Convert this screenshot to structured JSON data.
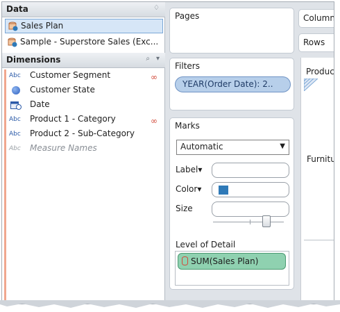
{
  "data_pane": {
    "header": "Data",
    "header_control": "♢",
    "sources": [
      {
        "label": "Sales Plan",
        "selected": true
      },
      {
        "label": "Sample - Superstore Sales (Exc...",
        "selected": false
      }
    ]
  },
  "dimensions_pane": {
    "header": "Dimensions",
    "search_glyph": "⌕",
    "menu_glyph": "▾",
    "items": [
      {
        "label": "Customer Segment",
        "type": "Abc",
        "linked": true
      },
      {
        "label": "Customer State",
        "type": "globe",
        "linked": false
      },
      {
        "label": "Date",
        "type": "calendar",
        "linked": false
      },
      {
        "label": "Product 1 - Category",
        "type": "Abc",
        "linked": true
      },
      {
        "label": "Product 2 - Sub-Category",
        "type": "Abc",
        "linked": false
      },
      {
        "label": "Measure Names",
        "type": "Abc",
        "linked": false
      }
    ],
    "type_abbrev": "Abc",
    "link_glyph": "∞"
  },
  "pages": {
    "title": "Pages"
  },
  "filters": {
    "title": "Filters",
    "pill": "YEAR(Order Date): 2.."
  },
  "marks": {
    "title": "Marks",
    "mark_type": "Automatic",
    "dropdown_glyph": "▼",
    "label_btn": "Label▾",
    "color_btn": "Color▾",
    "size_btn": "Size",
    "level_of_detail": "Level of Detail",
    "measure_pill": "SUM(Sales Plan)",
    "color_swatch": "#2f7ab8"
  },
  "shelves": {
    "columns": "Columns",
    "rows": "Rows"
  },
  "viz": {
    "row_header_1": "Product-",
    "row_header_2": "Furnitur"
  }
}
